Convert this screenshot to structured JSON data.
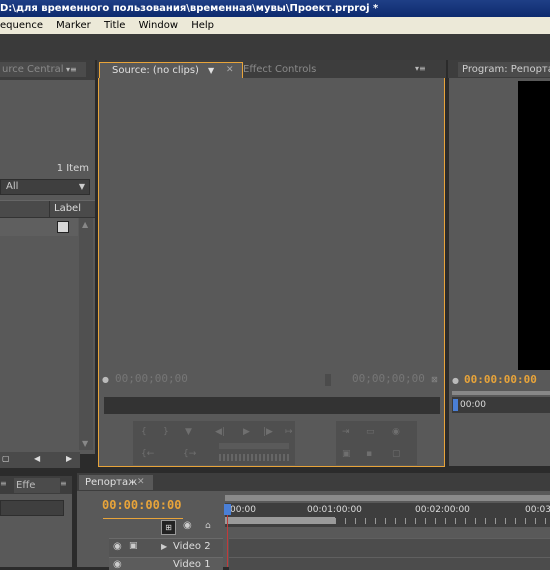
{
  "window": {
    "title": "D:\\для временного пользования\\временная\\мувы\\Проект.prproj *"
  },
  "menu": [
    "equence",
    "Marker",
    "Title",
    "Window",
    "Help"
  ],
  "project_panel": {
    "tab_label": "urce Central",
    "item_count": "1 Item",
    "filter_value": "All",
    "column_label": "Label"
  },
  "source_panel": {
    "tab_source": "Source: (no clips)",
    "tab_effect_controls": "Effect Controls",
    "timecode_left": "00;00;00;00",
    "timecode_right": "00;00;00;00"
  },
  "program_panel": {
    "tab_label": "Program: Репортаж",
    "timecode": "00:00:00:00",
    "ruler_start": "00:00"
  },
  "lower_left": {
    "tab_effects": "Effe"
  },
  "timeline": {
    "tab_label": "Репортаж",
    "timecode": "00:00:00:00",
    "ruler_labels": [
      ":00:00",
      "00:01:00:00",
      "00:02:00:00",
      "00:03"
    ],
    "tracks": [
      {
        "name": "Video 2"
      },
      {
        "name": "Video 1"
      }
    ]
  },
  "colors": {
    "timecode": "#e8a43a",
    "title_bar": "#0d2a6e",
    "playhead": "#4a7fd6"
  }
}
